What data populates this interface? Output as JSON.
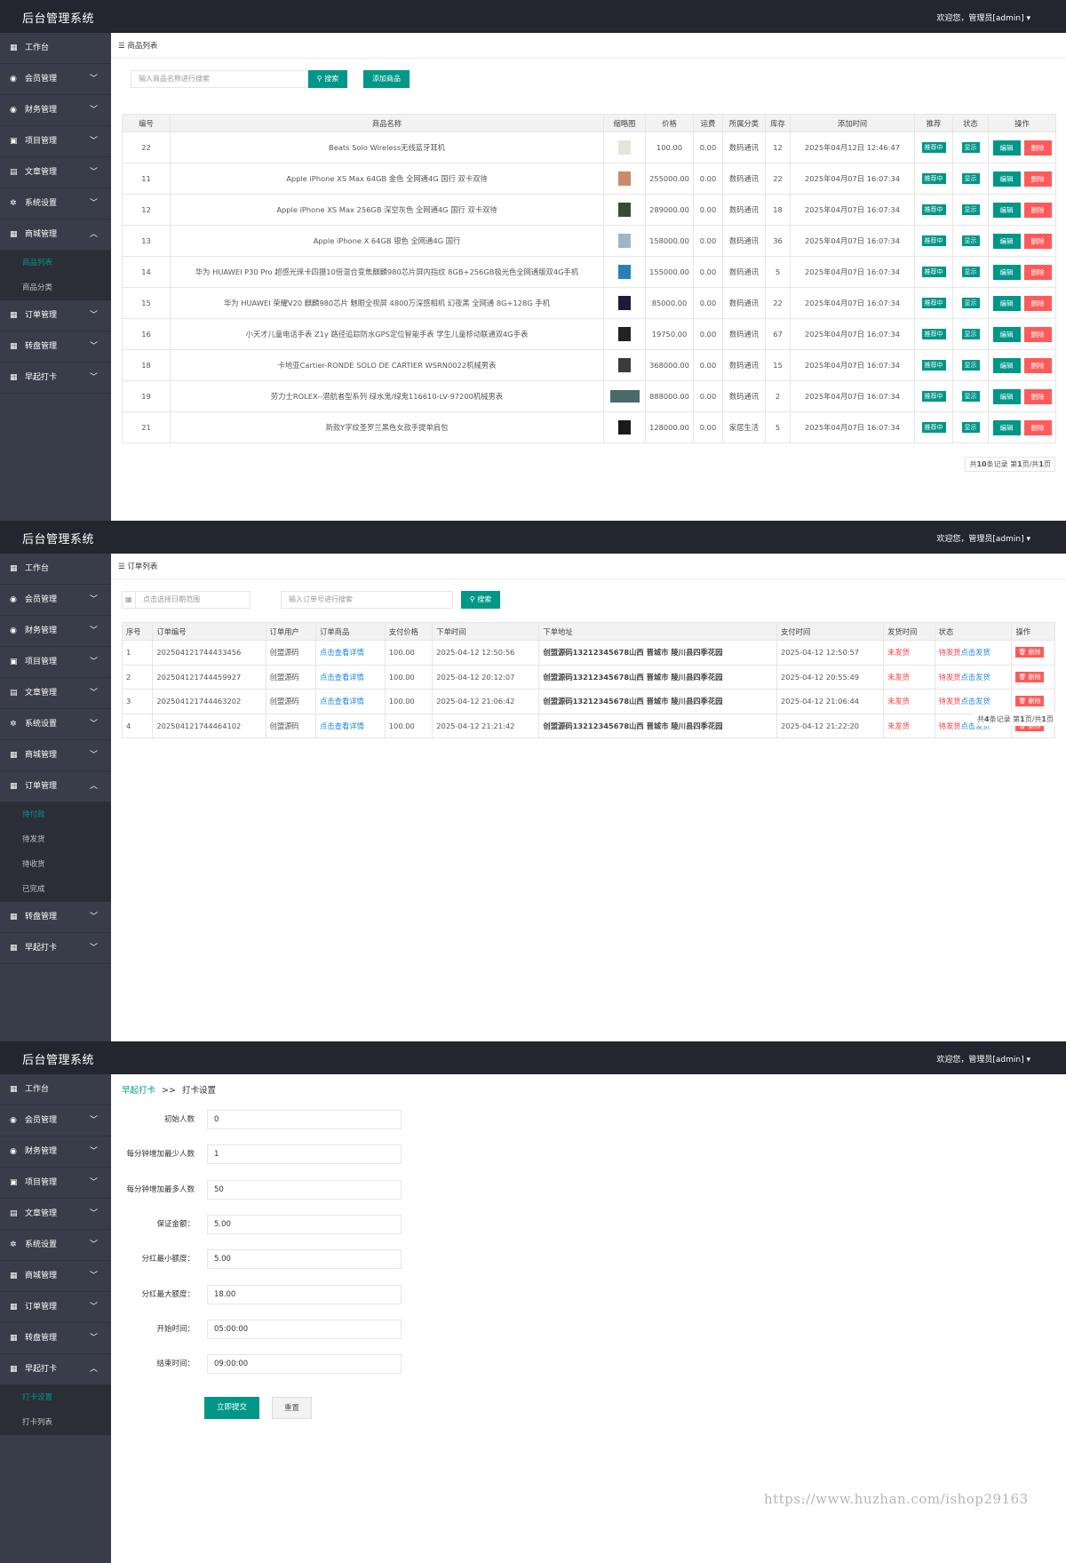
{
  "app": {
    "title": "后台管理系统",
    "user": "欢迎您，管理员[admin]"
  },
  "sidebar": {
    "workbench": "工作台",
    "items": [
      "会员管理",
      "财务管理",
      "项目管理",
      "文章管理",
      "系统设置",
      "商城管理",
      "订单管理",
      "转盘管理",
      "早起打卡"
    ],
    "shop_sub": [
      "商品列表",
      "商品分类"
    ],
    "order_sub": [
      "待付款",
      "待发货",
      "待收货",
      "已完成"
    ],
    "checkin_sub": [
      "打卡设置",
      "打卡列表"
    ]
  },
  "products": {
    "panel_title": "商品列表",
    "search_placeholder": "输入商品名称进行搜索",
    "search_label": "搜索",
    "add_label": "添加商品",
    "columns": [
      "编号",
      "商品名称",
      "缩略图",
      "价格",
      "运费",
      "所属分类",
      "库存",
      "添加时间",
      "推荐",
      "状态",
      "操作"
    ],
    "rows": [
      {
        "id": "22",
        "name": "Beats Solo Wireless无线蓝牙耳机",
        "price": "100.00",
        "freight": "0.00",
        "category": "数码通讯",
        "stock": "12",
        "time": "2025年04月12日 12:46:47",
        "thumb": "#e8e4dc"
      },
      {
        "id": "11",
        "name": "Apple iPhone XS Max 64GB 金色 全网通4G 国行 双卡双待",
        "price": "255000.00",
        "freight": "0.00",
        "category": "数码通讯",
        "stock": "22",
        "time": "2025年04月07日 16:07:34",
        "thumb": "#c98a6e"
      },
      {
        "id": "12",
        "name": "Apple iPhone XS Max 256GB 深空灰色 全网通4G 国行 双卡双待",
        "price": "289000.00",
        "freight": "0.00",
        "category": "数码通讯",
        "stock": "18",
        "time": "2025年04月07日 16:07:34",
        "thumb": "#3a4a3a"
      },
      {
        "id": "13",
        "name": "Apple iPhone X 64GB 银色 全网通4G 国行",
        "price": "158000.00",
        "freight": "0.00",
        "category": "数码通讯",
        "stock": "36",
        "time": "2025年04月07日 16:07:34",
        "thumb": "#9fb6c9"
      },
      {
        "id": "14",
        "name": "华为 HUAWEI P30 Pro 超感光徕卡四摄10倍混合变焦麒麟980芯片屏内指纹 8GB+256GB极光色全网通版双4G手机",
        "price": "155000.00",
        "freight": "0.00",
        "category": "数码通讯",
        "stock": "5",
        "time": "2025年04月07日 16:07:34",
        "thumb": "#2a7fb8"
      },
      {
        "id": "15",
        "name": "华为 HUAWEI 荣耀V20 麒麟980芯片 魅眼全视屏 4800万深感相机 幻夜黑 全网通 8G+128G 手机",
        "price": "85000.00",
        "freight": "0.00",
        "category": "数码通讯",
        "stock": "22",
        "time": "2025年04月07日 16:07:34",
        "thumb": "#1c1c3a"
      },
      {
        "id": "16",
        "name": "小天才儿童电话手表 Z1y 路径追踪防水GPS定位智能手表 学生儿童移动联通双4G手表",
        "price": "19750.00",
        "freight": "0.00",
        "category": "数码通讯",
        "stock": "67",
        "time": "2025年04月07日 16:07:34",
        "thumb": "#222222"
      },
      {
        "id": "18",
        "name": "卡地亚Cartier-RONDE SOLO DE CARTIER WSRN0022机械男表",
        "price": "368000.00",
        "freight": "0.00",
        "category": "数码通讯",
        "stock": "15",
        "time": "2025年04月07日 16:07:34",
        "thumb": "#3b3b3b"
      },
      {
        "id": "19",
        "name": "劳力士ROLEX--潜航者型系列 绿水鬼/绿鬼116610-LV-97200机械男表",
        "price": "888000.00",
        "freight": "0.00",
        "category": "数码通讯",
        "stock": "2",
        "time": "2025年04月07日 16:07:34",
        "thumb": "#4a6a6a"
      },
      {
        "id": "21",
        "name": "新款Y字纹圣罗兰黑色女款手提单肩包",
        "price": "128000.00",
        "freight": "0.00",
        "category": "家居生活",
        "stock": "5",
        "time": "2025年04月07日 16:07:34",
        "thumb": "#1a1a1a"
      }
    ],
    "tag_recommend": "推荐中",
    "tag_status": "显示",
    "edit_label": "编辑",
    "delete_label": "删除",
    "pager": {
      "prefix": "共",
      "total": "10",
      "mid": "条记录 第",
      "page": "1",
      "sep": "页/共",
      "pages": "1",
      "suffix": "页"
    }
  },
  "orders": {
    "panel_title": "订单列表",
    "date_placeholder": "点击选择日期范围",
    "search_placeholder": "输入订单号进行搜索",
    "search_label": "搜索",
    "columns": [
      "序号",
      "订单编号",
      "订单用户",
      "订单商品",
      "支付价格",
      "下单时间",
      "下单地址",
      "支付时间",
      "发货时间",
      "状态",
      "操作"
    ],
    "rows": [
      {
        "no": "1",
        "order_no": "2025041217444334​56",
        "user": "创盟源码",
        "goods": "点击查看详情",
        "price": "100.00",
        "time": "2025-04-12 12:50:56",
        "address": "创盟源码13212345678山西 晋城市 陵川县四季花园",
        "paid": "2025-04-12 12:50:57",
        "ship": "未发货",
        "status": "待发货",
        "status_action": "点击发货"
      },
      {
        "no": "2",
        "order_no": "202504121744459927",
        "user": "创盟源码",
        "goods": "点击查看详情",
        "price": "100.00",
        "time": "2025-04-12 20:12:07",
        "address": "创盟源码13212345678山西 晋城市 陵川县四季花园",
        "paid": "2025-04-12 20:55:49",
        "ship": "未发货",
        "status": "待发货",
        "status_action": "点击发货"
      },
      {
        "no": "3",
        "order_no": "202504121744463202",
        "user": "创盟源码",
        "goods": "点击查看详情",
        "price": "100.00",
        "time": "2025-04-12 21:06:42",
        "address": "创盟源码13212345678山西 晋城市 陵川县四季花园",
        "paid": "2025-04-12 21:06:44",
        "ship": "未发货",
        "status": "待发货",
        "status_action": "点击发货"
      },
      {
        "no": "4",
        "order_no": "202504121744464102",
        "user": "创盟源码",
        "goods": "点击查看详情",
        "price": "100.00",
        "time": "2025-04-12 21:21:42",
        "address": "创盟源码13212345678山西 晋城市 陵川县四季花园",
        "paid": "2025-04-12 21:22:20",
        "ship": "未发货",
        "status": "待发货",
        "status_action": "点击发货"
      }
    ],
    "delete_label": "删除",
    "pager": {
      "prefix": "共",
      "total": "4",
      "mid": "条记录 第",
      "page": "1",
      "sep": "页/共",
      "pages": "1",
      "suffix": "页"
    }
  },
  "checkin": {
    "breadcrumb_parent": "早起打卡",
    "breadcrumb_sep": ">>",
    "breadcrumb_current": "打卡设置",
    "fields": [
      {
        "label": "初始人数",
        "value": "0"
      },
      {
        "label": "每分钟增加最少人数",
        "value": "1"
      },
      {
        "label": "每分钟增加最多人数",
        "value": "50"
      },
      {
        "label": "保证金额：",
        "value": "5.00"
      },
      {
        "label": "分红最小额度：",
        "value": "5.00"
      },
      {
        "label": "分红最大额度：",
        "value": "18.00"
      },
      {
        "label": "开始时间：",
        "value": "05:00:00"
      },
      {
        "label": "结束时间：",
        "value": "09:00:00"
      }
    ],
    "submit_label": "立即提交",
    "reset_label": "重置"
  },
  "watermark": "https://www.huzhan.com/ishop29163",
  "colors": {
    "topbar": "#23262e",
    "sidebar": "#393d49",
    "primary": "#009688",
    "danger": "#ff5a5a"
  }
}
